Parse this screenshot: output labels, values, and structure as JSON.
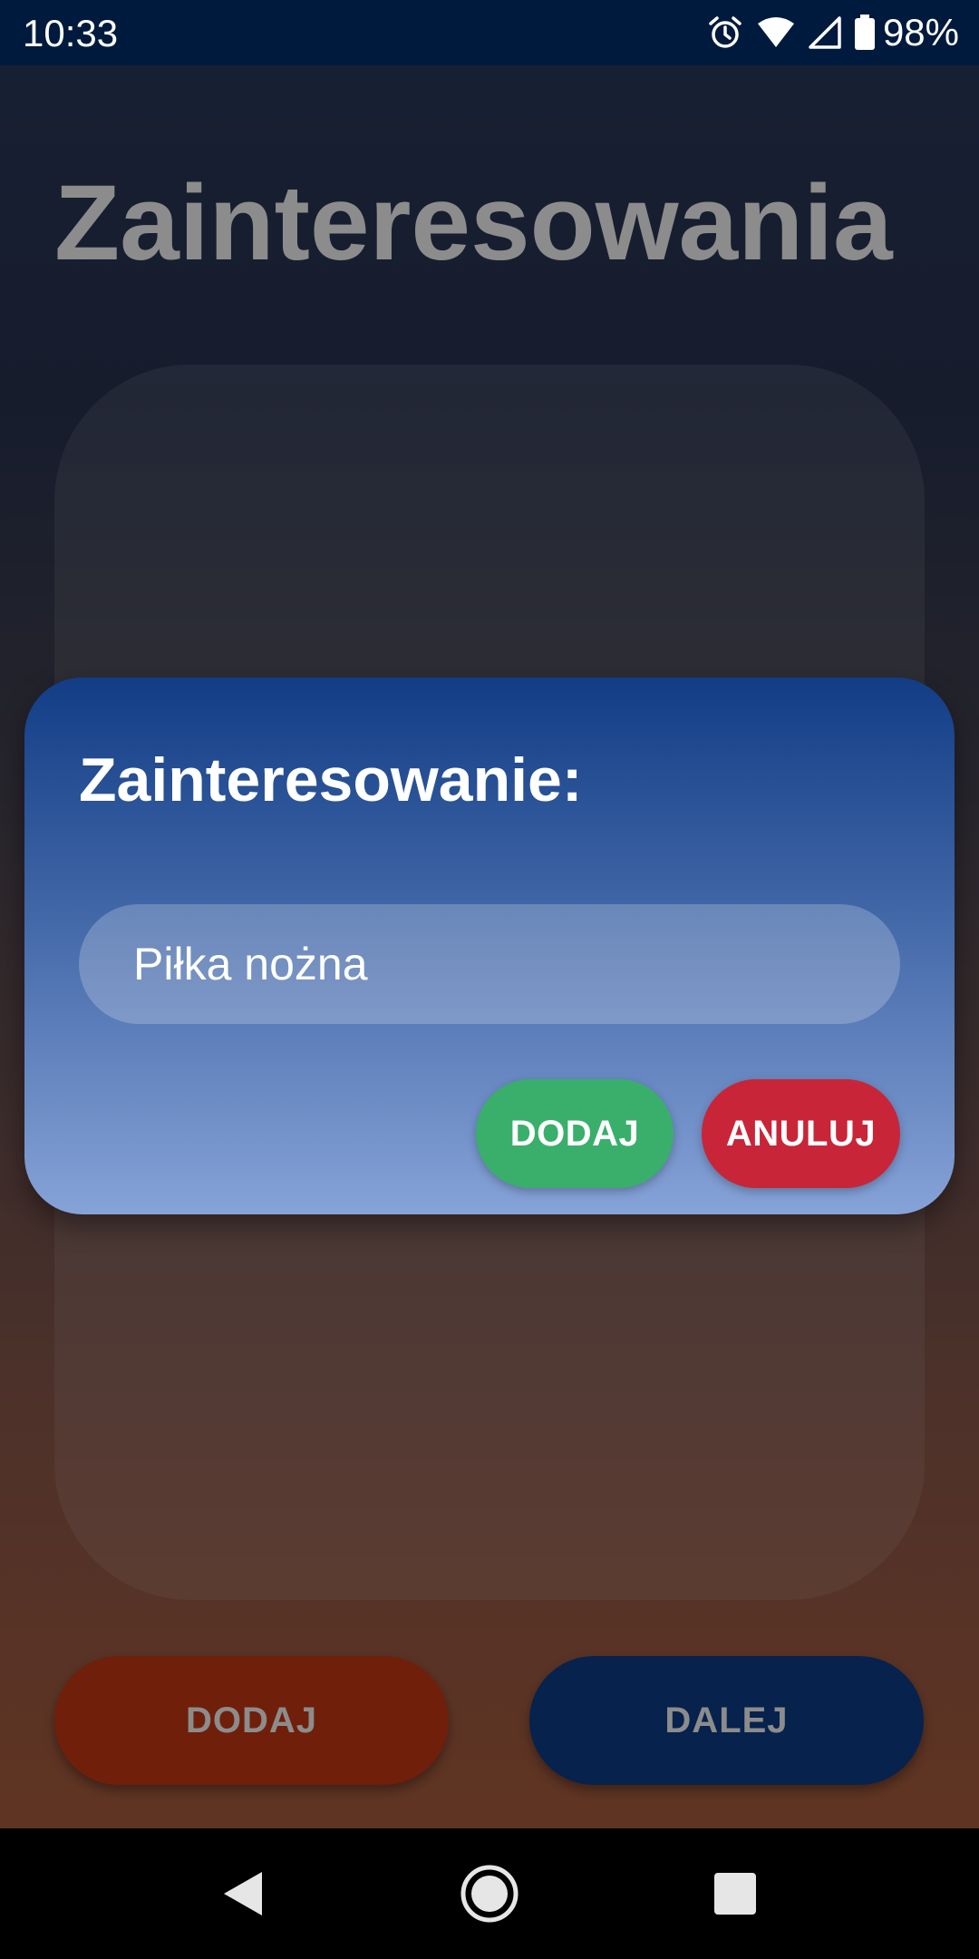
{
  "status_bar": {
    "time": "10:33",
    "battery": "98%",
    "icons": [
      "alarm-icon",
      "wifi-icon",
      "signal-icon",
      "battery-icon"
    ]
  },
  "page": {
    "title": "Zainteresowania",
    "add_button": "DODAJ",
    "next_button": "DALEJ"
  },
  "dialog": {
    "title": "Zainteresowanie:",
    "input_value": "Piłka nożna",
    "confirm_button": "DODAJ",
    "cancel_button": "ANULUJ"
  },
  "navigation": {
    "icons": [
      "back-icon",
      "home-icon",
      "recents-icon"
    ]
  },
  "colors": {
    "status_bar": "#001a3d",
    "confirm": "#3aaf6b",
    "cancel": "#c82538",
    "add": "#cc3a14",
    "next": "#0b3f8c"
  }
}
